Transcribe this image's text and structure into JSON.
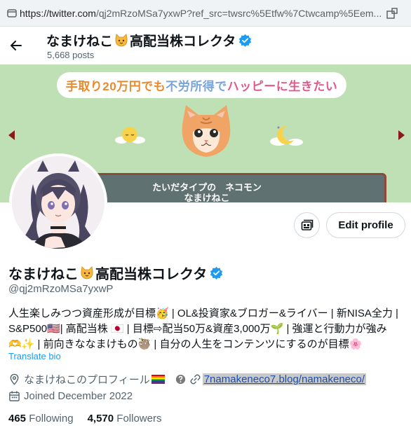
{
  "browser": {
    "url_host": "https://twitter.com",
    "url_path": "/qj2mRzoMSa7yxwP?ref_src=twsrc%5Etfw%7Ctwcamp%5Eem..."
  },
  "header": {
    "name_part1": "なまけねこ",
    "name_part2": "高配当株コレクタ",
    "posts": "5,668 posts"
  },
  "banner": {
    "tagline_part1": "手取り20万円でも",
    "tagline_part2": "不労所得で",
    "tagline_part3": "ハッピーに生きたい",
    "sign_line1": "たいだタイプの　ネコモン",
    "sign_line2": "なまけねこ"
  },
  "actions": {
    "edit_profile": "Edit profile"
  },
  "profile": {
    "name_part1": "なまけねこ",
    "name_part2": "高配当株コレクタ",
    "handle": "@qj2mRzoMSa7yxwP",
    "bio_line1": "人生楽しみつつ資産形成が目標🥳 | OL&投資家&ブロガー&ライバー | 新NISA全力 |",
    "bio_line2": "S&P500🇺🇸| 高配当株 🇯🇵 | 目標⇨配当50万&資産3,000万🌱 | 強運と行動力が強み",
    "bio_line3": "🫶✨ | 前向きななまけもの🦥 | 自分の人生をコンテンツにするのが目標🌸",
    "translate": "Translate bio",
    "location": "なまけねこのプロフィール",
    "website": "7namakeneco7.blog/namakeneco/",
    "joined": "Joined December 2022",
    "following_count": "465",
    "following_label": "Following",
    "followers_count": "4,570",
    "followers_label": "Followers"
  },
  "colors": {
    "accent": "#1d9bf0",
    "verified": "#1d9bf0",
    "banner_bg": "#bfe0b4",
    "sign_bg": "#5f7271"
  }
}
